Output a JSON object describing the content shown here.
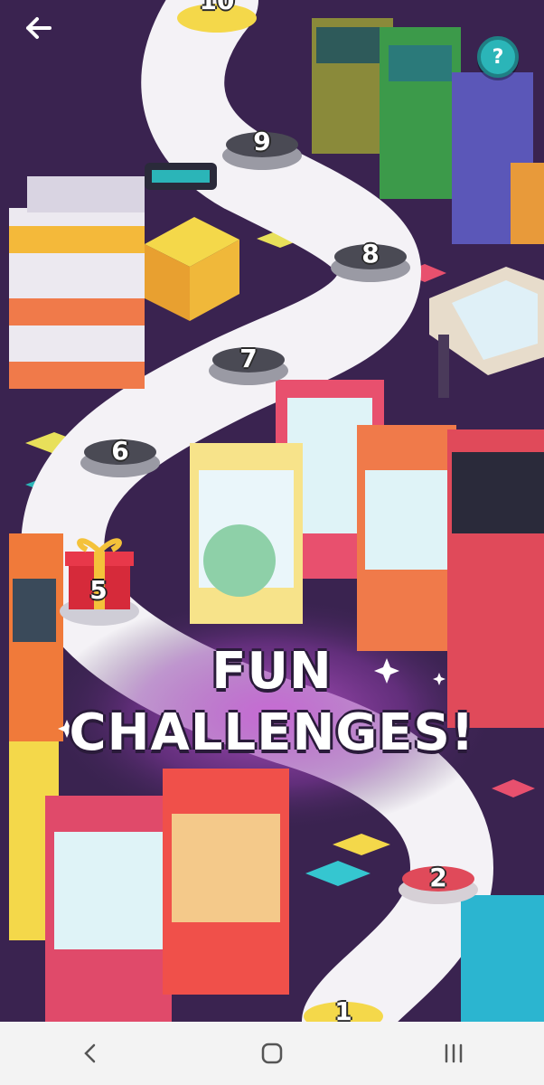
{
  "topbar": {
    "back_icon": "arrow-left-icon",
    "help_icon": "question-mark-icon",
    "help_label": "?"
  },
  "map": {
    "levels": [
      {
        "label": "10"
      },
      {
        "label": "9"
      },
      {
        "label": "8"
      },
      {
        "label": "7"
      },
      {
        "label": "6"
      },
      {
        "label": "5"
      },
      {
        "label": "2"
      },
      {
        "label": "1"
      }
    ],
    "bonus_level_label": "5"
  },
  "headline": {
    "line1": "FUN",
    "line2": "CHALLENGES!"
  },
  "colors": {
    "background": "#3a2350",
    "path": "#f4f2f6",
    "teal": "#2bb5b8",
    "pink": "#e8506e",
    "yellow": "#ffd54a"
  },
  "navbar": {
    "back_icon": "chevron-left-icon",
    "home_icon": "home-square-icon",
    "recents_icon": "recents-lines-icon"
  }
}
